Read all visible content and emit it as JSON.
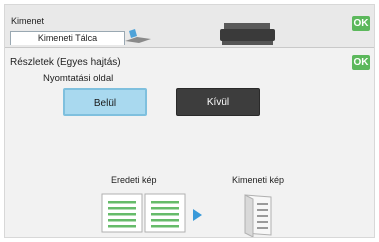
{
  "header": {
    "title": "Kimenet",
    "tab_label": "Kimeneti Tálca",
    "ok_label": "OK"
  },
  "section": {
    "heading": "Részletek (Egyes hajtás)",
    "ok_label": "OK",
    "sublabel": "Nyomtatási oldal"
  },
  "options": {
    "inside_label": "Belül",
    "outside_label": "Kívül",
    "selected": "Belül"
  },
  "preview": {
    "original_label": "Eredeti kép",
    "output_label": "Kimeneti kép"
  },
  "colors": {
    "ok": "#5cb85c",
    "selected_option": "#a9d9ef",
    "unselected_option": "#3d3d3d",
    "arrow": "#3a9ad9",
    "line_icon": "#66bb6a"
  }
}
